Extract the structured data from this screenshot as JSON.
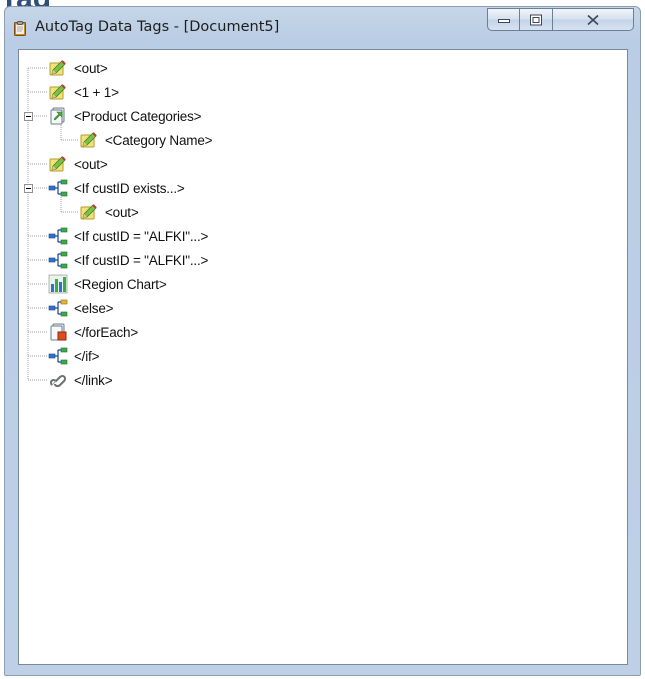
{
  "window": {
    "title": "AutoTag Data Tags - [Document5]"
  },
  "tree": {
    "items": [
      {
        "label": "<out>",
        "icon": "pencil-tag-icon",
        "depth": 1
      },
      {
        "label": "<1 + 1>",
        "icon": "pencil-tag-icon",
        "depth": 1
      },
      {
        "label": "<Product Categories>",
        "icon": "foreach-loop-icon",
        "depth": 0,
        "expanded": true
      },
      {
        "label": "<Category Name>",
        "icon": "pencil-tag-icon",
        "depth": 2
      },
      {
        "label": "<out>",
        "icon": "pencil-tag-icon",
        "depth": 1
      },
      {
        "label": "<If custID exists...>",
        "icon": "if-branch-icon",
        "depth": 0,
        "expanded": true
      },
      {
        "label": "<out>",
        "icon": "pencil-tag-icon",
        "depth": 2
      },
      {
        "label": "<If custID = \"ALFKI\"...>",
        "icon": "if-branch-icon",
        "depth": 1
      },
      {
        "label": "<If custID = \"ALFKI\"...>",
        "icon": "if-branch-icon",
        "depth": 1
      },
      {
        "label": "<Region Chart>",
        "icon": "bar-chart-icon",
        "depth": 1
      },
      {
        "label": "<else>",
        "icon": "else-branch-icon",
        "depth": 1
      },
      {
        "label": "</forEach>",
        "icon": "foreach-end-icon",
        "depth": 1
      },
      {
        "label": "</if>",
        "icon": "if-end-icon",
        "depth": 1
      },
      {
        "label": "</link>",
        "icon": "link-icon",
        "depth": 1
      }
    ]
  },
  "heading_fragment": "Tag"
}
